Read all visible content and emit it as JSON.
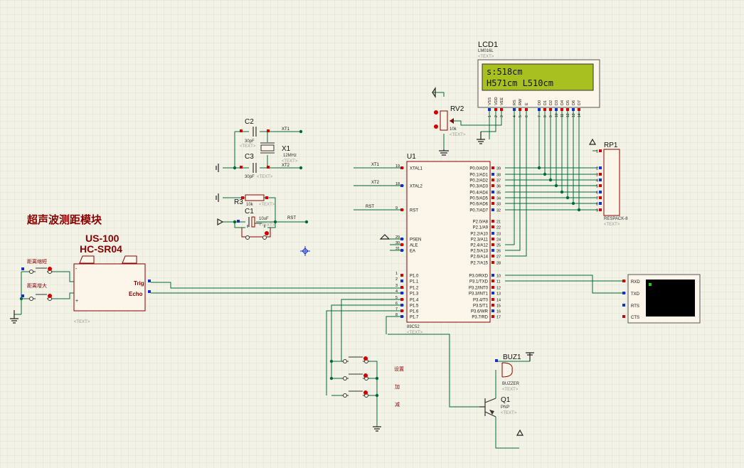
{
  "colors": {
    "background": "#f2f2e6",
    "grid": "#e2e2d2",
    "wire": "#006b3c",
    "body_fill": "#fbf6e9",
    "body_stroke": "#8b0000",
    "pin_red": "#d40000",
    "pin_blue": "#1030d0",
    "lcd_screen": "#a8c020",
    "terminal_screen": "#000000"
  },
  "module_title_cn": "超声波测距模块",
  "us100": {
    "title1": "US-100",
    "title2": "HC-SR04",
    "trig": "Trig",
    "echo": "Echo",
    "text": "<TEXT>"
  },
  "buttons_left": {
    "dec": "距离缩短",
    "inc": "距离增大"
  },
  "lcd": {
    "ref": "LCD1",
    "part": "LM016L",
    "text": "<TEXT>",
    "line1": "s:518cm",
    "line2": "H571cm  L510cm",
    "pins": [
      "VSS",
      "VDD",
      "VEE",
      "RS",
      "RW",
      "E",
      "D0",
      "D1",
      "D2",
      "D3",
      "D4",
      "D5",
      "D6",
      "D7"
    ],
    "pin_nums": [
      "1",
      "2",
      "3",
      "4",
      "5",
      "6",
      "7",
      "8",
      "9",
      "10",
      "11",
      "12",
      "13",
      "14"
    ]
  },
  "rv2": {
    "ref": "RV2",
    "value": "10k",
    "text": "<TEXT>"
  },
  "c2": {
    "ref": "C2",
    "value": "30pF",
    "text": "<TEXT>"
  },
  "c3": {
    "ref": "C3",
    "value": "30pF",
    "text": "<TEXT>"
  },
  "x1": {
    "ref": "X1",
    "value": "12MHz",
    "text": "<TEXT>"
  },
  "r3": {
    "ref": "R3",
    "value": "10k",
    "text": "<TEXT>"
  },
  "c1": {
    "ref": "C1",
    "value": "10uF",
    "text": "<TEXT>"
  },
  "nets": {
    "xt1": "XT1",
    "xt2": "XT2",
    "rst": "RST"
  },
  "u1": {
    "ref": "U1",
    "part": "89C52",
    "text": "<TEXT>",
    "left_pins": [
      {
        "num": "19",
        "name": "XTAL1"
      },
      {
        "num": "18",
        "name": "XTAL2"
      },
      {
        "num": "9",
        "name": "RST"
      },
      {
        "num": "29",
        "name": "PSEN"
      },
      {
        "num": "30",
        "name": "ALE"
      },
      {
        "num": "31",
        "name": "EA"
      },
      {
        "num": "1",
        "name": "P1.0"
      },
      {
        "num": "2",
        "name": "P1.1"
      },
      {
        "num": "3",
        "name": "P1.2"
      },
      {
        "num": "4",
        "name": "P1.3"
      },
      {
        "num": "5",
        "name": "P1.4"
      },
      {
        "num": "6",
        "name": "P1.5"
      },
      {
        "num": "7",
        "name": "P1.6"
      },
      {
        "num": "8",
        "name": "P1.7"
      }
    ],
    "right_pins": [
      {
        "num": "39",
        "name": "P0.0/AD0"
      },
      {
        "num": "38",
        "name": "P0.1/AD1"
      },
      {
        "num": "37",
        "name": "P0.2/AD2"
      },
      {
        "num": "36",
        "name": "P0.3/AD3"
      },
      {
        "num": "35",
        "name": "P0.4/AD4"
      },
      {
        "num": "34",
        "name": "P0.5/AD5"
      },
      {
        "num": "33",
        "name": "P0.6/AD6"
      },
      {
        "num": "32",
        "name": "P0.7/AD7"
      },
      {
        "num": "21",
        "name": "P2.0/A8"
      },
      {
        "num": "22",
        "name": "P2.1/A9"
      },
      {
        "num": "23",
        "name": "P2.2/A10"
      },
      {
        "num": "24",
        "name": "P2.3/A11"
      },
      {
        "num": "25",
        "name": "P2.4/A12"
      },
      {
        "num": "26",
        "name": "P2.5/A13"
      },
      {
        "num": "27",
        "name": "P2.6/A14"
      },
      {
        "num": "28",
        "name": "P2.7/A15"
      },
      {
        "num": "10",
        "name": "P3.0/RXD"
      },
      {
        "num": "11",
        "name": "P3.1/TXD"
      },
      {
        "num": "12",
        "name": "P3.2/INT0"
      },
      {
        "num": "13",
        "name": "P3.3/INT1"
      },
      {
        "num": "14",
        "name": "P3.4/T0"
      },
      {
        "num": "15",
        "name": "P3.5/T1"
      },
      {
        "num": "16",
        "name": "P3.6/WR"
      },
      {
        "num": "17",
        "name": "P3.7/RD"
      }
    ]
  },
  "rp1": {
    "ref": "RP1",
    "part": "RESPACK-8",
    "text": "<TEXT>",
    "pin_nums": [
      "1",
      "2",
      "3",
      "4",
      "5",
      "6",
      "7",
      "8",
      "9"
    ]
  },
  "terminal": {
    "pins": [
      "RXD",
      "TXD",
      "RTS",
      "CTS"
    ]
  },
  "buz1": {
    "ref": "BUZ1",
    "part": "BUZZER",
    "text": "<TEXT>"
  },
  "q1": {
    "ref": "Q1",
    "part": "PNP",
    "text": "<TEXT>"
  },
  "buttons_bottom": {
    "set": "设置",
    "add": "加",
    "sub": "减"
  }
}
